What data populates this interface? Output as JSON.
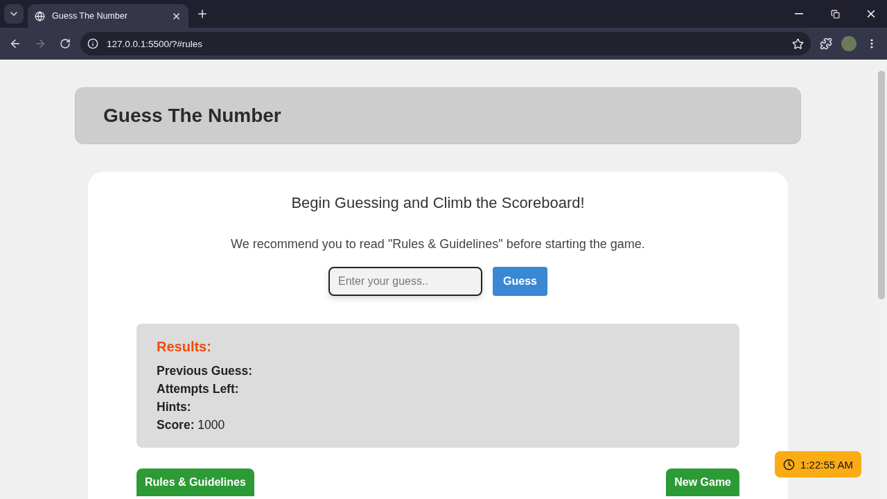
{
  "browser": {
    "tab": {
      "title": "Guess The Number",
      "selected": true
    },
    "url": "127.0.0.1:5500/?#rules"
  },
  "header": {
    "title": "Guess The Number"
  },
  "game": {
    "heading": "Begin Guessing and Climb the Scoreboard!",
    "recommendation": "We recommend you to read \"Rules & Guidelines\" before starting the game.",
    "guess_input": {
      "placeholder": "Enter your guess.."
    },
    "guess_button": "Guess",
    "results": {
      "title": "Results:",
      "fields": [
        {
          "label": "Previous Guess:"
        },
        {
          "label": "Attempts Left:"
        },
        {
          "label": "Hints:"
        },
        {
          "label": "Score:",
          "value": "1000"
        }
      ]
    },
    "buttons": [
      {
        "label": "Rules & Guidelines"
      },
      {
        "label": "New Game"
      }
    ]
  },
  "clock": {
    "time": "1:22:55 AM"
  }
}
